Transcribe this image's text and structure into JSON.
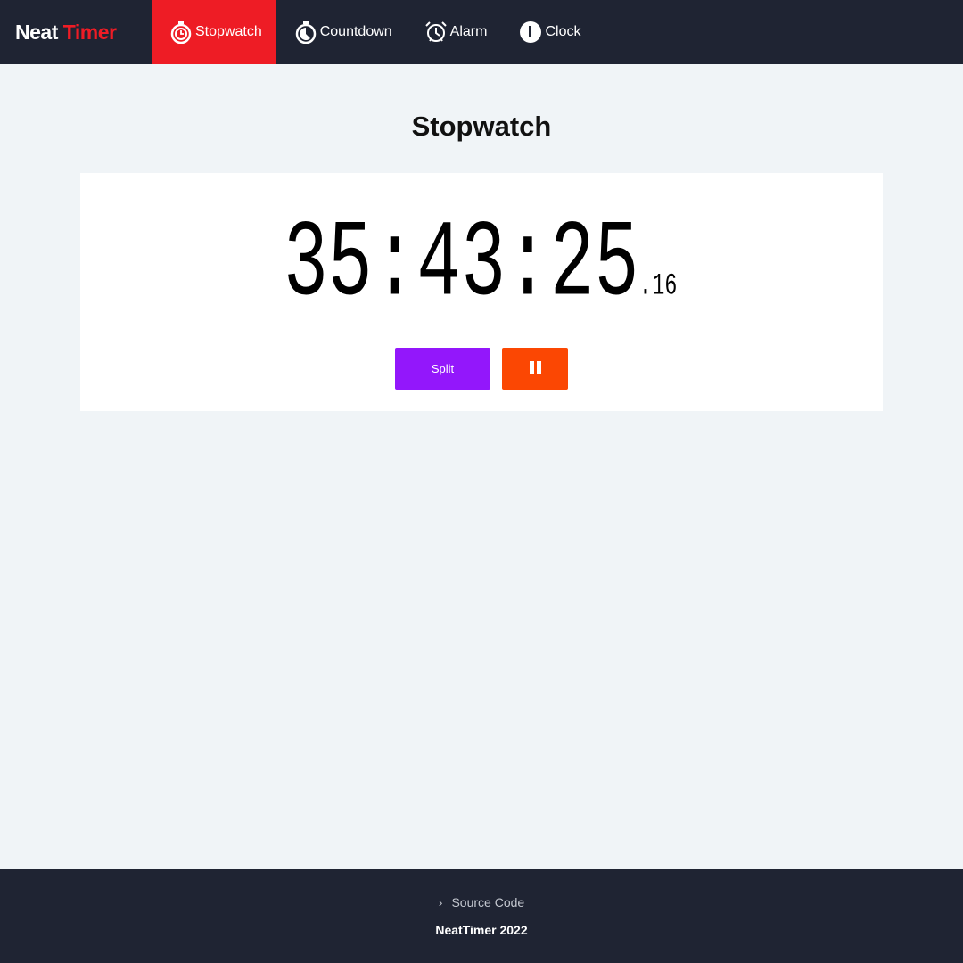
{
  "brand": {
    "part1": "Neat",
    "part2": "Timer"
  },
  "nav": [
    {
      "label": "Stopwatch",
      "icon": "stopwatch-icon",
      "active": true
    },
    {
      "label": "Countdown",
      "icon": "timer-icon",
      "active": false
    },
    {
      "label": "Alarm",
      "icon": "alarm-clock-icon",
      "active": false
    },
    {
      "label": "Clock",
      "icon": "clock-icon",
      "active": false
    }
  ],
  "page_title": "Stopwatch",
  "timer": {
    "main": "35:43:25",
    "fraction": "16"
  },
  "buttons": {
    "split": "Split",
    "pause_icon": "pause-icon"
  },
  "footer": {
    "source": "Source Code",
    "copyright": "NeatTimer 2022"
  },
  "colors": {
    "nav_bg": "#1f2433",
    "accent": "#ee1c25",
    "split": "#9317fb",
    "pause": "#fb4703"
  }
}
